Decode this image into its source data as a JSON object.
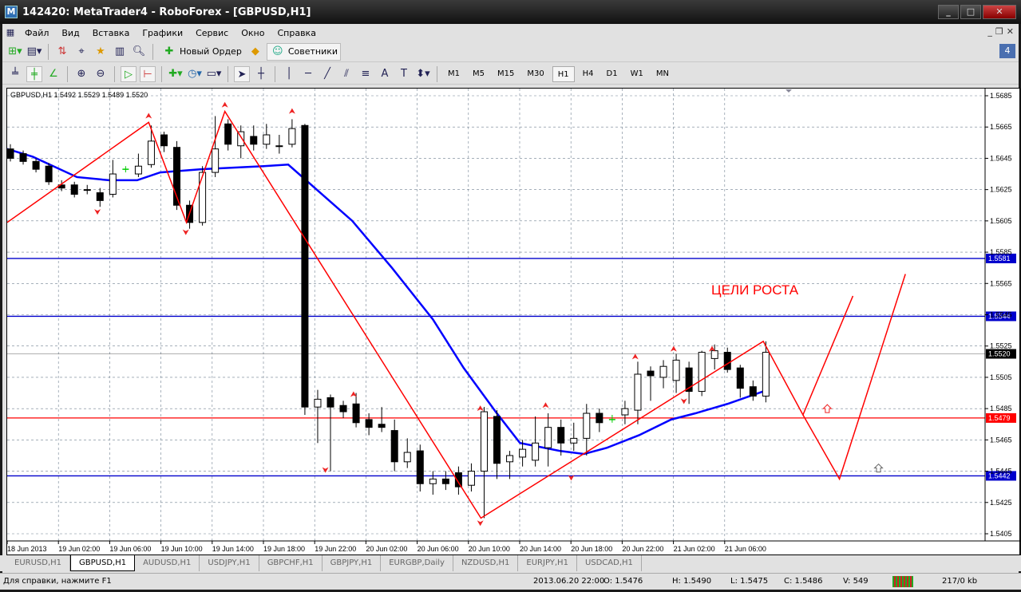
{
  "window": {
    "title": "142420: MetaTrader4 - RoboForex - [GBPUSD,H1]",
    "min": "_",
    "max": "□",
    "close": "✕"
  },
  "menu": [
    "Файл",
    "Вид",
    "Вставка",
    "Графики",
    "Сервис",
    "Окно",
    "Справка"
  ],
  "toolbar": {
    "new_order": "Новый Ордер",
    "experts": "Советники",
    "notify_count": "4"
  },
  "timeframes": [
    "M1",
    "M5",
    "M15",
    "M30",
    "H1",
    "H4",
    "D1",
    "W1",
    "MN"
  ],
  "active_timeframe": "H1",
  "chart": {
    "header": "GBPUSD,H1  1.5492 1.5529 1.5489 1.5520",
    "annotation": "ЦЕЛИ РОСТА",
    "price_ticks": [
      "1.5685",
      "1.5665",
      "1.5645",
      "1.5625",
      "1.5605",
      "1.5585",
      "1.5565",
      "1.5545",
      "1.5525",
      "1.5505",
      "1.5485",
      "1.5465",
      "1.5445",
      "1.5425",
      "1.5405"
    ],
    "time_labels": [
      "18 Jun 2013",
      "19 Jun 02:00",
      "19 Jun 06:00",
      "19 Jun 10:00",
      "19 Jun 14:00",
      "19 Jun 18:00",
      "19 Jun 22:00",
      "20 Jun 02:00",
      "20 Jun 06:00",
      "20 Jun 10:00",
      "20 Jun 14:00",
      "20 Jun 18:00",
      "20 Jun 22:00",
      "21 Jun 02:00",
      "21 Jun 06:00"
    ],
    "levels": [
      {
        "price": 1.5581,
        "label": "1.5581",
        "color": "#0000cc"
      },
      {
        "price": 1.5544,
        "label": "1.5544",
        "color": "#0000cc"
      },
      {
        "price": 1.5442,
        "label": "1.5442",
        "color": "#0000cc"
      },
      {
        "price": 1.5479,
        "label": "1.5479",
        "color": "#ff0000"
      },
      {
        "price": 1.552,
        "label": "1.5520",
        "color": "#000000"
      }
    ],
    "colors": {
      "bull": "#ffffff",
      "bear": "#000000",
      "doji": "#00cc00",
      "ma": "#0000ff",
      "zigzag": "#ff0000",
      "grid": "#708090"
    }
  },
  "chart_data": {
    "type": "candlestick",
    "symbol": "GBPUSD",
    "timeframe": "H1",
    "ylim": [
      1.5405,
      1.5685
    ],
    "candles": [
      [
        1.5651,
        1.5654,
        1.5643,
        1.5645
      ],
      [
        1.5648,
        1.565,
        1.5641,
        1.5643
      ],
      [
        1.5643,
        1.5645,
        1.5636,
        1.5638
      ],
      [
        1.564,
        1.5642,
        1.5628,
        1.563
      ],
      [
        1.5628,
        1.5631,
        1.5624,
        1.5626
      ],
      [
        1.5628,
        1.563,
        1.562,
        1.5622
      ],
      [
        1.5625,
        1.5628,
        1.5622,
        1.5625
      ],
      [
        1.5623,
        1.5626,
        1.5614,
        1.5618
      ],
      [
        1.5622,
        1.5644,
        1.562,
        1.5635
      ],
      [
        1.5638,
        1.564,
        1.5636,
        1.5638
      ],
      [
        1.5635,
        1.5648,
        1.5633,
        1.564
      ],
      [
        1.5641,
        1.5666,
        1.5639,
        1.5656
      ],
      [
        1.566,
        1.5662,
        1.5649,
        1.5653
      ],
      [
        1.5652,
        1.5656,
        1.5612,
        1.5615
      ],
      [
        1.5615,
        1.5618,
        1.56,
        1.5604
      ],
      [
        1.5604,
        1.564,
        1.5602,
        1.5636
      ],
      [
        1.5636,
        1.5672,
        1.5633,
        1.5651
      ],
      [
        1.5667,
        1.567,
        1.565,
        1.5654
      ],
      [
        1.5653,
        1.5666,
        1.5645,
        1.5662
      ],
      [
        1.5659,
        1.5666,
        1.565,
        1.5654
      ],
      [
        1.5654,
        1.5667,
        1.5651,
        1.566
      ],
      [
        1.5653,
        1.566,
        1.5648,
        1.5653
      ],
      [
        1.5654,
        1.567,
        1.5652,
        1.5664
      ],
      [
        1.5666,
        1.5667,
        1.5481,
        1.5486
      ],
      [
        1.5486,
        1.5497,
        1.5463,
        1.5491
      ],
      [
        1.5492,
        1.5494,
        1.5445,
        1.5486
      ],
      [
        1.5487,
        1.549,
        1.5479,
        1.5483
      ],
      [
        1.5488,
        1.5495,
        1.5473,
        1.5476
      ],
      [
        1.5478,
        1.5482,
        1.5468,
        1.5473
      ],
      [
        1.5475,
        1.5486,
        1.547,
        1.5473
      ],
      [
        1.5471,
        1.5478,
        1.5445,
        1.5451
      ],
      [
        1.5451,
        1.5466,
        1.5447,
        1.5457
      ],
      [
        1.5458,
        1.5462,
        1.5432,
        1.5437
      ],
      [
        1.5437,
        1.5445,
        1.543,
        1.544
      ],
      [
        1.544,
        1.5445,
        1.5433,
        1.5437
      ],
      [
        1.5444,
        1.5448,
        1.543,
        1.5435
      ],
      [
        1.5436,
        1.545,
        1.5432,
        1.5445
      ],
      [
        1.5445,
        1.5486,
        1.5415,
        1.5483
      ],
      [
        1.548,
        1.5484,
        1.544,
        1.545
      ],
      [
        1.5451,
        1.5458,
        1.544,
        1.5455
      ],
      [
        1.5454,
        1.5465,
        1.5448,
        1.5459
      ],
      [
        1.5452,
        1.548,
        1.5448,
        1.5463
      ],
      [
        1.546,
        1.5482,
        1.5448,
        1.5473
      ],
      [
        1.5473,
        1.5478,
        1.5455,
        1.5463
      ],
      [
        1.5463,
        1.5476,
        1.5458,
        1.5466
      ],
      [
        1.5466,
        1.5488,
        1.5455,
        1.5482
      ],
      [
        1.5482,
        1.5485,
        1.547,
        1.5476
      ],
      [
        1.5478,
        1.5481,
        1.5476,
        1.5478
      ],
      [
        1.5481,
        1.549,
        1.5475,
        1.5485
      ],
      [
        1.5484,
        1.5515,
        1.5475,
        1.5507
      ],
      [
        1.5509,
        1.5512,
        1.549,
        1.5506
      ],
      [
        1.5505,
        1.5516,
        1.5498,
        1.5512
      ],
      [
        1.5503,
        1.552,
        1.5495,
        1.5516
      ],
      [
        1.5511,
        1.5515,
        1.5488,
        1.5496
      ],
      [
        1.5496,
        1.5522,
        1.5493,
        1.5521
      ],
      [
        1.5517,
        1.5526,
        1.551,
        1.5522
      ],
      [
        1.5521,
        1.5524,
        1.5508,
        1.551
      ],
      [
        1.5511,
        1.5513,
        1.5492,
        1.5498
      ],
      [
        1.5499,
        1.5503,
        1.549,
        1.5493
      ],
      [
        1.5493,
        1.5528,
        1.5489,
        1.5521
      ]
    ],
    "doji_indices": [
      9,
      47
    ],
    "moving_average": [
      [
        -0.25,
        1.5651
      ],
      [
        1.75,
        1.5646
      ],
      [
        5.2,
        1.5633
      ],
      [
        7.7,
        1.5631
      ],
      [
        9.9,
        1.5631
      ],
      [
        11.7,
        1.5636
      ],
      [
        14.9,
        1.5638
      ],
      [
        19.8,
        1.564
      ],
      [
        21.7,
        1.5641
      ],
      [
        24.2,
        1.5623
      ],
      [
        26.7,
        1.5605
      ],
      [
        29.8,
        1.5575
      ],
      [
        33,
        1.5542
      ],
      [
        35.4,
        1.5511
      ],
      [
        37.9,
        1.5483
      ],
      [
        39.8,
        1.5463
      ],
      [
        42.9,
        1.5458
      ],
      [
        44.8,
        1.5456
      ],
      [
        46.6,
        1.546
      ],
      [
        49.1,
        1.5468
      ],
      [
        51.6,
        1.5478
      ],
      [
        53.5,
        1.5482
      ],
      [
        56,
        1.5488
      ],
      [
        58.8,
        1.5496
      ]
    ],
    "zigzag": [
      [
        -0.25,
        1.5604
      ],
      [
        10.8,
        1.5668
      ],
      [
        13.75,
        1.5604
      ],
      [
        16.75,
        1.5675
      ],
      [
        36.75,
        1.5415
      ],
      [
        58.8,
        1.5528
      ],
      [
        61.9,
        1.5481
      ],
      [
        65.8,
        1.5557
      ]
    ],
    "projection": [
      [
        61.9,
        1.5481
      ],
      [
        64.75,
        1.544
      ],
      [
        69.9,
        1.5571
      ]
    ],
    "fractals_up": [
      [
        10.8,
        1.5672
      ],
      [
        16.75,
        1.5679
      ],
      [
        22,
        1.5675
      ],
      [
        26.8,
        1.5494
      ],
      [
        36.7,
        1.5485
      ],
      [
        41.8,
        1.5487
      ],
      [
        48.8,
        1.5518
      ],
      [
        51.8,
        1.5523
      ],
      [
        54.8,
        1.5523
      ]
    ],
    "fractals_down": [
      [
        6.8,
        1.5611
      ],
      [
        13.7,
        1.5598
      ],
      [
        24.6,
        1.5446
      ],
      [
        36.7,
        1.5412
      ],
      [
        43.8,
        1.5441
      ],
      [
        52.6,
        1.549
      ]
    ],
    "target_arrows": [
      [
        63.8,
        1.5485
      ],
      [
        67.8,
        1.5447
      ]
    ]
  },
  "tabs": [
    "EURUSD,H1",
    "GBPUSD,H1",
    "AUDUSD,H1",
    "USDJPY,H1",
    "GBPCHF,H1",
    "GBPJPY,H1",
    "EURGBP,Daily",
    "NZDUSD,H1",
    "EURJPY,H1",
    "USDCAD,H1"
  ],
  "active_tab": "GBPUSD,H1",
  "status": {
    "help": "Для справки, нажмите F1",
    "datetime": "2013.06.20 22:00",
    "open": "O: 1.5476",
    "high": "H: 1.5490",
    "low": "L: 1.5475",
    "close": "C: 1.5486",
    "volume": "V: 549",
    "traffic": "217/0 kb"
  }
}
